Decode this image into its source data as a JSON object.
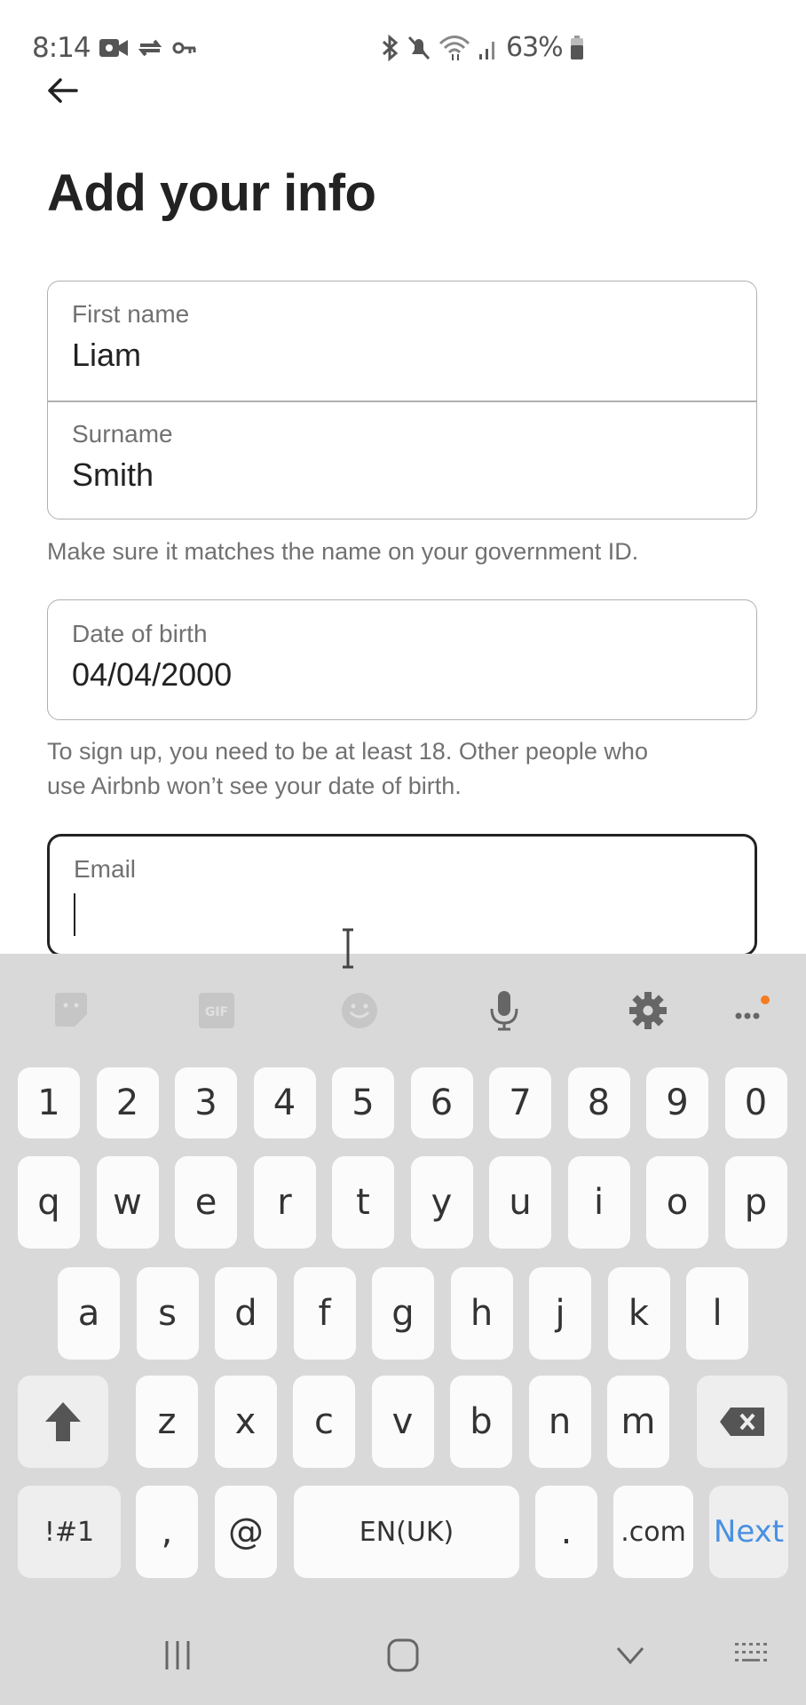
{
  "status_bar": {
    "time": "8:14",
    "left_icons": [
      "video-recording-icon",
      "sync-icon",
      "vpn-key-icon"
    ],
    "right_icons": [
      "bluetooth-icon",
      "mute-icon",
      "wifi-icon",
      "signal-icon"
    ],
    "battery_percent": "63%"
  },
  "header": {
    "back_icon": "arrow-left-icon",
    "title": "Add your info"
  },
  "form": {
    "first_name": {
      "label": "First name",
      "value": "Liam"
    },
    "surname": {
      "label": "Surname",
      "value": "Smith"
    },
    "name_hint": "Make sure it matches the name on your government ID.",
    "date_of_birth": {
      "label": "Date of birth",
      "value": "04/04/2000"
    },
    "dob_hint_line1": "To sign up, you need to be at least 18. Other people who",
    "dob_hint_line2": "use Airbnb won’t see your date of birth.",
    "email": {
      "label": "Email",
      "value": ""
    }
  },
  "keyboard": {
    "toolbar": [
      "sticker-icon",
      "gif-icon",
      "emoji-icon",
      "microphone-icon",
      "settings-icon",
      "more-icon"
    ],
    "accent_color": "#4a90e2",
    "notification_dot_color": "#f47c20",
    "row_numbers": [
      "1",
      "2",
      "3",
      "4",
      "5",
      "6",
      "7",
      "8",
      "9",
      "0"
    ],
    "row_top": [
      "q",
      "w",
      "e",
      "r",
      "t",
      "y",
      "u",
      "i",
      "o",
      "p"
    ],
    "row_middle": [
      "a",
      "s",
      "d",
      "f",
      "g",
      "h",
      "j",
      "k",
      "l"
    ],
    "row_bottom": [
      "z",
      "x",
      "c",
      "v",
      "b",
      "n",
      "m"
    ],
    "symbols_key": "!#1",
    "comma_key": ",",
    "at_key": "@",
    "space_key": "EN(UK)",
    "period_key": ".",
    "dotcom_key": ".com",
    "next_key": "Next"
  },
  "nav_bar": [
    "recent-apps-icon",
    "home-icon",
    "back-chevron-icon",
    "keyboard-switch-icon"
  ]
}
